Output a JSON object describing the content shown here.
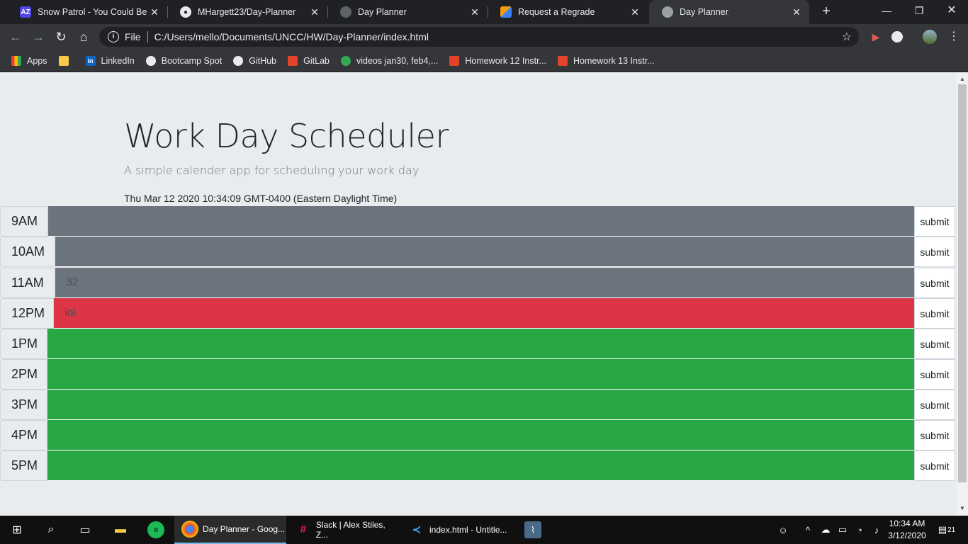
{
  "browser": {
    "tabs": [
      {
        "title": "Snow Patrol - You Could Be Happy",
        "active": false
      },
      {
        "title": "MHargett23/Day-Planner",
        "active": false
      },
      {
        "title": "Day Planner",
        "active": false
      },
      {
        "title": "Request a Regrade",
        "active": false
      },
      {
        "title": "Day Planner",
        "active": true
      }
    ],
    "address": {
      "scheme_label": "File",
      "url": "C:/Users/mello/Documents/UNCC/HW/Day-Planner/index.html"
    },
    "bookmarks": [
      {
        "label": "Apps",
        "icon": "apps-grid-icon"
      },
      {
        "label": "",
        "icon": "folder-icon"
      },
      {
        "label": "LinkedIn",
        "icon": "linkedin-icon"
      },
      {
        "label": "Bootcamp Spot",
        "icon": "bootcamp-icon"
      },
      {
        "label": "GitHub",
        "icon": "github-icon"
      },
      {
        "label": "GitLab",
        "icon": "gitlab-icon"
      },
      {
        "label": "videos jan30, feb4,...",
        "icon": "drive-icon"
      },
      {
        "label": "Homework 12 Instr...",
        "icon": "gitlab-icon"
      },
      {
        "label": "Homework 13 Instr...",
        "icon": "gitlab-icon"
      }
    ]
  },
  "app": {
    "title": "Work Day Scheduler",
    "lead": "A simple calender app for scheduling your work day",
    "current_day": "Thu Mar 12 2020 10:34:09 GMT-0400 (Eastern Daylight Time)",
    "submit_label": "submit",
    "hours": [
      {
        "label": "9AM",
        "text": "",
        "state": "past"
      },
      {
        "label": "10AM",
        "text": "",
        "state": "past"
      },
      {
        "label": "11AM",
        "text": "32",
        "state": "past"
      },
      {
        "label": "12PM",
        "text": "ioi",
        "state": "present"
      },
      {
        "label": "1PM",
        "text": "",
        "state": "future"
      },
      {
        "label": "2PM",
        "text": "",
        "state": "future"
      },
      {
        "label": "3PM",
        "text": "",
        "state": "future"
      },
      {
        "label": "4PM",
        "text": "",
        "state": "future"
      },
      {
        "label": "5PM",
        "text": "",
        "state": "future"
      }
    ],
    "colors": {
      "past": "#6c757d",
      "present": "#dc3545",
      "future": "#28a745"
    }
  },
  "taskbar": {
    "apps": [
      {
        "label": "Day Planner - Goog...",
        "icon": "chrome-icon"
      },
      {
        "label": "Slack | Alex Stiles, Z...",
        "icon": "slack-icon"
      },
      {
        "label": "index.html - Untitle...",
        "icon": "vscode-icon"
      }
    ],
    "time": "10:34 AM",
    "date": "3/12/2020",
    "notifications": "21"
  }
}
